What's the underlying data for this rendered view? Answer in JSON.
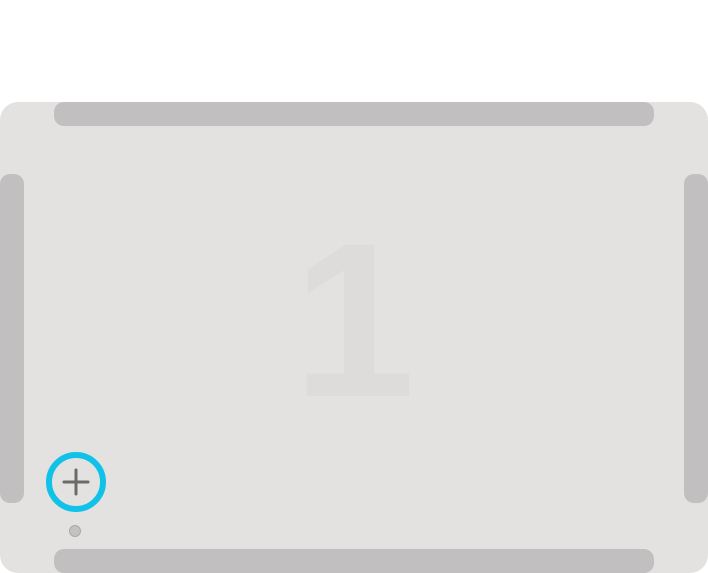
{
  "screen": {
    "number_label": "1"
  },
  "controls": {
    "add_button_icon": "plus-icon",
    "accent_color": "#11c2e8"
  },
  "colors": {
    "panel_background": "#e3e2e1",
    "edge_handles": "#c1bfbf"
  },
  "pagination": {
    "dots": 1,
    "current": 1
  }
}
